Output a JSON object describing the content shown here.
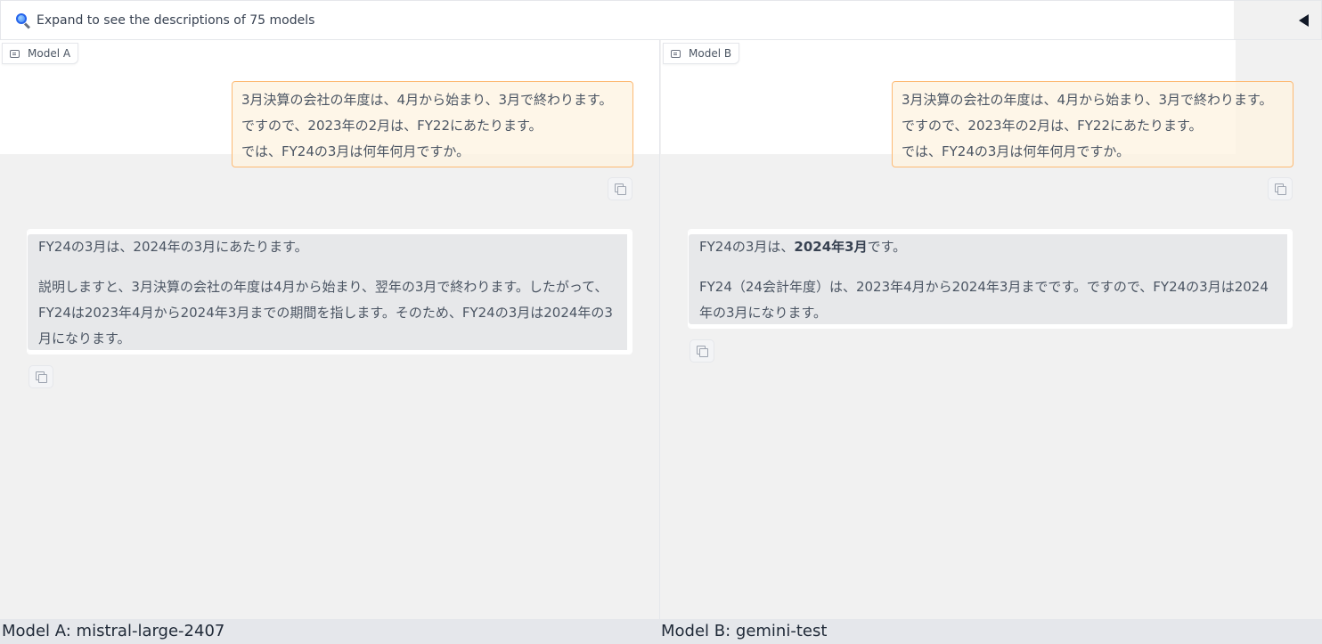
{
  "header": {
    "expand_text": "Expand to see the descriptions of 75 models",
    "icon": "magnifier-icon",
    "collapse_icon": "triangle-left-icon"
  },
  "panel_a": {
    "tag": "Model A",
    "user_message": [
      "3月決算の会社の年度は、4月から始まり、3月で終わります。",
      "ですので、2023年の2月は、FY22にあたります。",
      "では、FY24の3月は何年何月ですか。"
    ],
    "bot_message": {
      "p1": "FY24の3月は、2024年の3月にあたります。",
      "p2_line1": "説明しますと、3月決算の会社の年度は4月から始まり、翌年の3月で終わります。したがって、",
      "p2_line2": "FY24は2023年4月から2024年3月までの期間を指します。そのため、FY24の3月は2024年の3",
      "p2_line3": "月になります。"
    }
  },
  "panel_b": {
    "tag": "Model B",
    "user_message": [
      "3月決算の会社の年度は、4月から始まり、3月で終わります。",
      "ですので、2023年の2月は、FY22にあたります。",
      "では、FY24の3月は何年何月ですか。"
    ],
    "bot_message": {
      "p1_pre": "FY24の3月は、",
      "p1_bold": "2024年3月",
      "p1_post": "です。",
      "p2_line1": "FY24（24会計年度）は、2023年4月から2024年3月までです。ですので、FY24の3月は2024",
      "p2_line2": "年の3月になります。"
    }
  },
  "footer": {
    "model_a": "Model A: mistral-large-2407",
    "model_b": "Model B: gemini-test"
  },
  "colors": {
    "user_bubble_bg": "#fef3e0",
    "user_bubble_border": "#fdba74",
    "bot_bubble_bg": "#e7e8ea",
    "page_bg": "#f1f1f1"
  }
}
